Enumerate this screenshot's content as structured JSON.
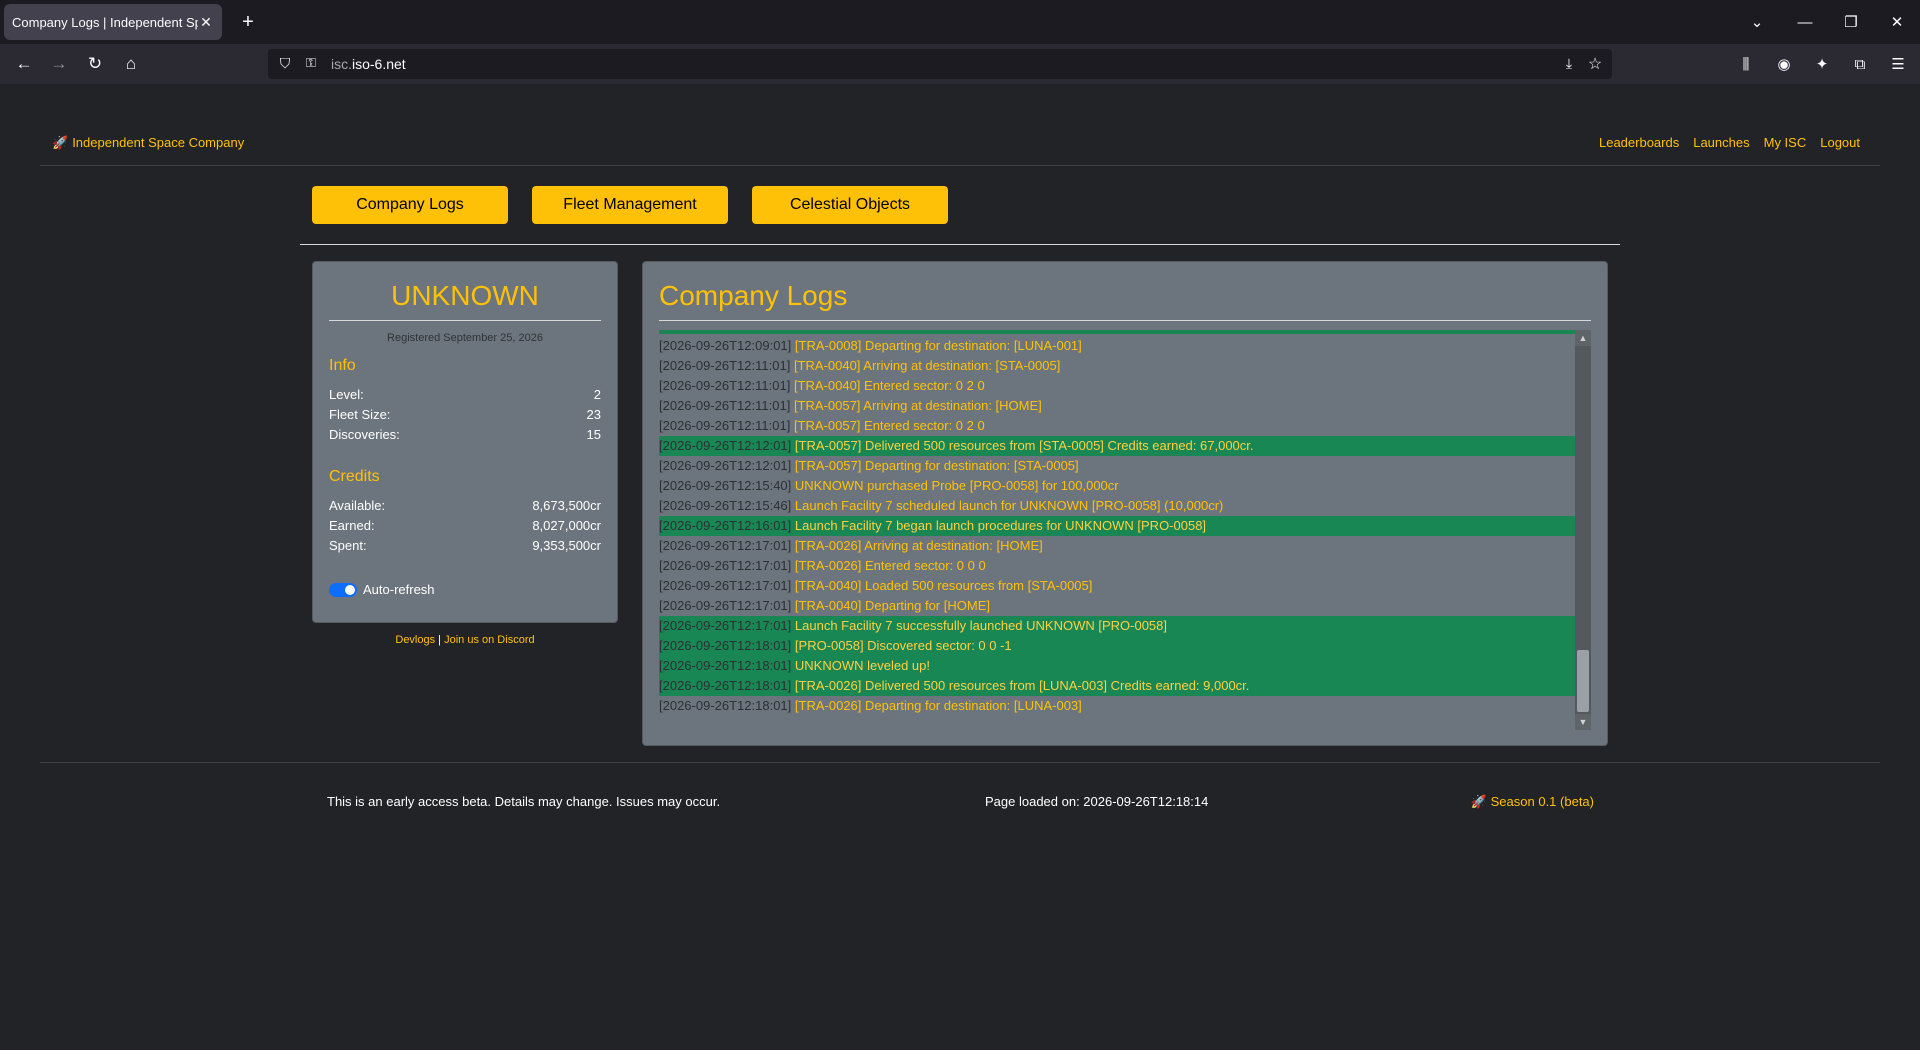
{
  "browser": {
    "tab_title": "Company Logs | Independent Space Company",
    "tab_close": "✕",
    "new_tab": "+",
    "url_host_prefix": "isc.",
    "url_host_main": "iso-6.net"
  },
  "site": {
    "brand": "Independent Space Company",
    "top_links": [
      "Leaderboards",
      "Launches",
      "My ISC",
      "Logout"
    ],
    "subnav": [
      "Company Logs",
      "Fleet Management",
      "Celestial Objects"
    ]
  },
  "profile": {
    "name": "UNKNOWN",
    "registered": "Registered September 25, 2026",
    "info_title": "Info",
    "info": [
      {
        "label": "Level:",
        "value": "2"
      },
      {
        "label": "Fleet Size:",
        "value": "23"
      },
      {
        "label": "Discoveries:",
        "value": "15"
      }
    ],
    "credits_title": "Credits",
    "credits": [
      {
        "label": "Available:",
        "value": "8,673,500cr"
      },
      {
        "label": "Earned:",
        "value": "8,027,000cr"
      },
      {
        "label": "Spent:",
        "value": "9,353,500cr"
      }
    ],
    "auto_refresh_label": "Auto-refresh",
    "auto_refresh_on": true
  },
  "footer_links": {
    "devlogs": "Devlogs",
    "separator": " | ",
    "discord": "Join us on Discord"
  },
  "logs": {
    "title": "Company Logs",
    "entries": [
      {
        "ts": "[2026-09-26T12:09:01]",
        "msg": "[TRA-0008] Departing for destination: [LUNA-001]",
        "hl": false
      },
      {
        "ts": "[2026-09-26T12:11:01]",
        "msg": "[TRA-0040] Arriving at destination: [STA-0005]",
        "hl": false
      },
      {
        "ts": "[2026-09-26T12:11:01]",
        "msg": "[TRA-0040] Entered sector: 0 2 0",
        "hl": false
      },
      {
        "ts": "[2026-09-26T12:11:01]",
        "msg": "[TRA-0057] Arriving at destination: [HOME]",
        "hl": false
      },
      {
        "ts": "[2026-09-26T12:11:01]",
        "msg": "[TRA-0057] Entered sector: 0 2 0",
        "hl": false
      },
      {
        "ts": "[2026-09-26T12:12:01]",
        "msg": "[TRA-0057] Delivered 500 resources from [STA-0005] Credits earned: 67,000cr.",
        "hl": true
      },
      {
        "ts": "[2026-09-26T12:12:01]",
        "msg": "[TRA-0057] Departing for destination: [STA-0005]",
        "hl": false
      },
      {
        "ts": "[2026-09-26T12:15:40]",
        "msg": "UNKNOWN purchased Probe [PRO-0058] for 100,000cr",
        "hl": false
      },
      {
        "ts": "[2026-09-26T12:15:46]",
        "msg": "Launch Facility 7 scheduled launch for UNKNOWN [PRO-0058] (10,000cr)",
        "hl": false
      },
      {
        "ts": "[2026-09-26T12:16:01]",
        "msg": "Launch Facility 7 began launch procedures for UNKNOWN [PRO-0058]",
        "hl": true
      },
      {
        "ts": "[2026-09-26T12:17:01]",
        "msg": "[TRA-0026] Arriving at destination: [HOME]",
        "hl": false
      },
      {
        "ts": "[2026-09-26T12:17:01]",
        "msg": "[TRA-0026] Entered sector: 0 0 0",
        "hl": false
      },
      {
        "ts": "[2026-09-26T12:17:01]",
        "msg": "[TRA-0040] Loaded 500 resources from [STA-0005]",
        "hl": false
      },
      {
        "ts": "[2026-09-26T12:17:01]",
        "msg": "[TRA-0040] Departing for [HOME]",
        "hl": false
      },
      {
        "ts": "[2026-09-26T12:17:01]",
        "msg": "Launch Facility 7 successfully launched UNKNOWN [PRO-0058]",
        "hl": true
      },
      {
        "ts": "[2026-09-26T12:18:01]",
        "msg": "[PRO-0058] Discovered sector: 0 0 -1",
        "hl": true
      },
      {
        "ts": "[2026-09-26T12:18:01]",
        "msg": "UNKNOWN leveled up!",
        "hl": true
      },
      {
        "ts": "[2026-09-26T12:18:01]",
        "msg": "[TRA-0026] Delivered 500 resources from [LUNA-003] Credits earned: 9,000cr.",
        "hl": true
      },
      {
        "ts": "[2026-09-26T12:18:01]",
        "msg": "[TRA-0026] Departing for destination: [LUNA-003]",
        "hl": false
      }
    ]
  },
  "footer": {
    "beta_note": "This is an early access beta. Details may change. Issues may occur.",
    "page_loaded": "Page loaded on: 2026-09-26T12:18:14",
    "season": "Season 0.1 (beta)"
  },
  "colors": {
    "accent": "#ffc107",
    "panel": "#6c757d",
    "highlight": "#198754",
    "background": "#212327"
  }
}
